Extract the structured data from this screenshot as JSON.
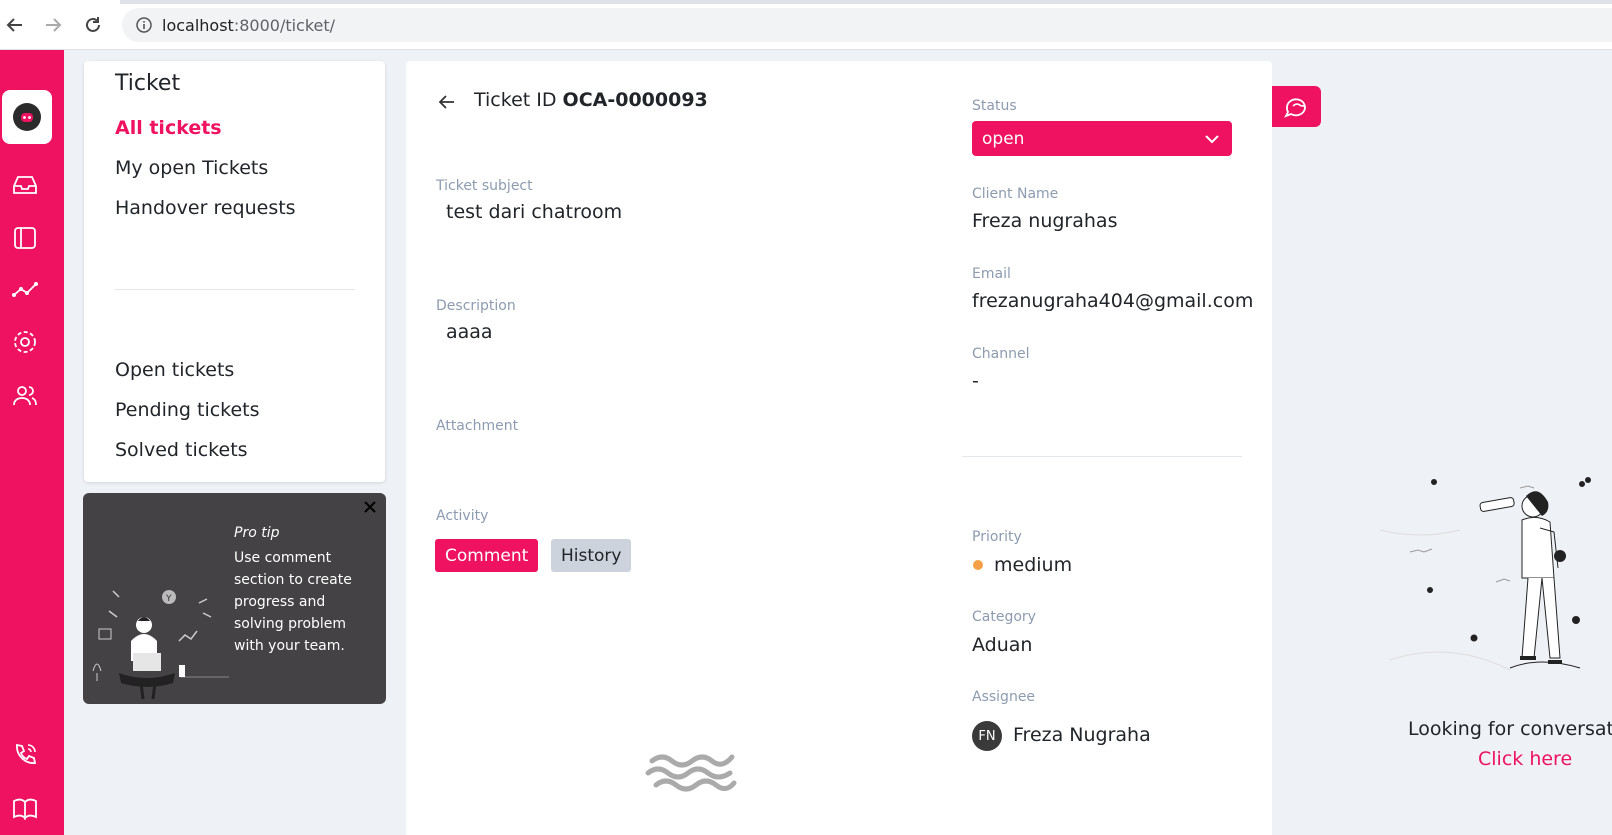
{
  "browser": {
    "url_host": "localhost",
    "url_path": ":8000/ticket/"
  },
  "colors": {
    "brand": "#ef1260",
    "priority_medium": "#f5a046"
  },
  "rail": {
    "icons": [
      "logo-icon",
      "inbox-icon",
      "panel-icon",
      "analytics-icon",
      "settings-icon",
      "users-icon",
      "phone-icon",
      "book-icon"
    ]
  },
  "menu": {
    "title": "Ticket",
    "items": [
      {
        "label": "All tickets"
      },
      {
        "label": "My open Tickets"
      },
      {
        "label": "Handover requests"
      },
      {
        "label": "Open tickets"
      },
      {
        "label": "Pending tickets"
      },
      {
        "label": "Solved tickets"
      }
    ]
  },
  "protip": {
    "heading": "Pro tip",
    "body": "Use comment section to create progress and solving problem with your team."
  },
  "ticket": {
    "id_prefix": "Ticket ID",
    "id": "OCA-0000093",
    "subject_label": "Ticket subject",
    "subject": "test dari chatroom",
    "description_label": "Description",
    "description": "aaaa",
    "attachment_label": "Attachment",
    "activity_label": "Activity",
    "tabs": {
      "comment": "Comment",
      "history": "History"
    }
  },
  "details": {
    "status_label": "Status",
    "status": "open",
    "client_label": "Client Name",
    "client": "Freza nugrahas",
    "email_label": "Email",
    "email": "frezanugraha404@gmail.com",
    "channel_label": "Channel",
    "channel": "-",
    "priority_label": "Priority",
    "priority": "medium",
    "category_label": "Category",
    "category": "Aduan",
    "assignee_label": "Assignee",
    "assignee_initials": "FN",
    "assignee": "Freza Nugraha"
  },
  "conversation": {
    "looking": "Looking for conversatio",
    "click": "Click here"
  }
}
